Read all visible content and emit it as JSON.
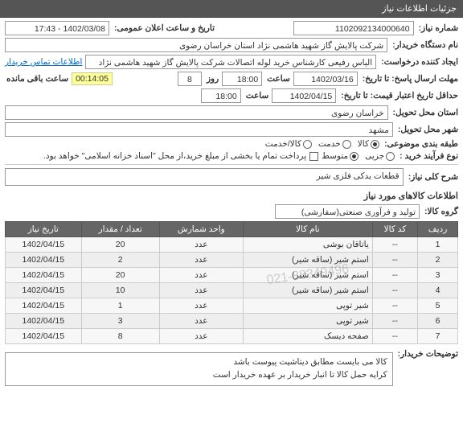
{
  "header": {
    "title": "جزئیات اطلاعات نیاز"
  },
  "form": {
    "need_no_label": "شماره نیاز:",
    "need_no": "1102092134000640",
    "announce_label": "تاریخ و ساعت اعلان عمومی:",
    "announce": "1402/03/08 - 17:43",
    "buyer_label": "نام دستگاه خریدار:",
    "buyer": "شرکت پالایش گاز شهید هاشمی نژاد   استان خراسان رضوی",
    "creator_label": "ایجاد کننده درخواست:",
    "creator": "الیاس رفیعی کارشناس خرید لوله اتصالات شرکت پالایش گاز شهید هاشمی نژاد",
    "contact_link": "اطلاعات تماس خریدار",
    "deadline_label": "مهلت ارسال پاسخ: تا تاریخ:",
    "deadline_date": "1402/03/16",
    "hour_label": "ساعت",
    "deadline_time": "18:00",
    "day_label": "روز",
    "days": "8",
    "remain_label": "ساعت باقی مانده",
    "remain": "00:14:05",
    "validity_label": "حداقل تاریخ اعتبار قیمت: تا تاریخ:",
    "validity_date": "1402/04/15",
    "validity_time": "18:00",
    "province_label": "استان محل تحویل:",
    "province": "خراسان رضوی",
    "city_label": "شهر محل تحویل:",
    "city": "مشهد",
    "class_label": "طبقه بندی موضوعی:",
    "class_goods": "کالا",
    "class_service": "خدمت",
    "class_both": "کالا/خدمت",
    "process_label": "نوع فرآیند خرید :",
    "process_small": "جزیی",
    "process_medium": "متوسط",
    "process_note": "پرداخت تمام یا بخشی از مبلغ خرید،از محل \"اسناد خزانه اسلامی\" خواهد بود.",
    "desc_label": "شرح کلی نیاز:",
    "desc": "قطعات یدکی فلزی شیر",
    "items_title": "اطلاعات کالاهای مورد نیاز",
    "group_label": "گروه کالا:",
    "group": "تولید و فرآوری صنعتی(سفارشی)",
    "buyer_notes_label": "توضیحات خریدار:",
    "buyer_notes_line1": "کالا  می  بایست  مطابق  دیتاشیت  پیوست  باشد",
    "buyer_notes_line2": "کرایه حمل کالا تا انبار خریدار بر عهده خریدار است"
  },
  "watermark": "021-88349496",
  "table": {
    "headers": {
      "row": "ردیف",
      "code": "کد کالا",
      "name": "نام کالا",
      "unit": "واحد شمارش",
      "qty": "تعداد / مقدار",
      "date": "تاریخ نیاز"
    },
    "rows": [
      {
        "row": 1,
        "code": "--",
        "name": "یاتاقان بوشی",
        "unit": "عدد",
        "qty": 20,
        "date": "1402/04/15"
      },
      {
        "row": 2,
        "code": "--",
        "name": "استم شیر (ساقه شیر)",
        "unit": "عدد",
        "qty": 2,
        "date": "1402/04/15"
      },
      {
        "row": 3,
        "code": "--",
        "name": "استم شیر (ساقه شیر)",
        "unit": "عدد",
        "qty": 20,
        "date": "1402/04/15"
      },
      {
        "row": 4,
        "code": "--",
        "name": "استم شیر (ساقه شیر)",
        "unit": "عدد",
        "qty": 10,
        "date": "1402/04/15"
      },
      {
        "row": 5,
        "code": "--",
        "name": "شیر توپی",
        "unit": "عدد",
        "qty": 1,
        "date": "1402/04/15"
      },
      {
        "row": 6,
        "code": "--",
        "name": "شیر توپی",
        "unit": "عدد",
        "qty": 3,
        "date": "1402/04/15"
      },
      {
        "row": 7,
        "code": "--",
        "name": "صفحه دیسک",
        "unit": "عدد",
        "qty": 8,
        "date": "1402/04/15"
      }
    ]
  }
}
